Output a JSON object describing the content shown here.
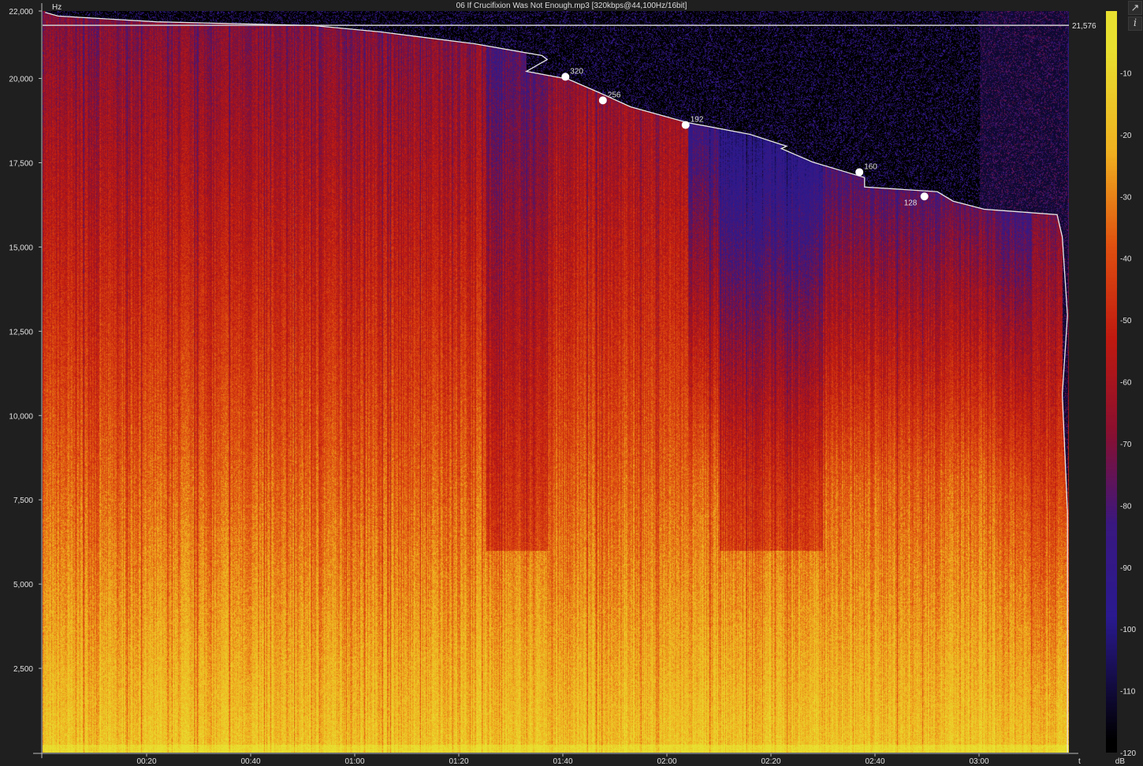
{
  "title": "06 If Crucifixion Was Not Enough.mp3 [320kbps@44,100Hz/16bit]",
  "toolbar": {
    "icons": [
      "open-external-icon",
      "info-icon"
    ],
    "info_label": "i"
  },
  "chart_data": {
    "type": "heatmap",
    "title": "06 If Crucifixion Was Not Enough.mp3 [320kbps@44,100Hz/16bit]",
    "xlabel": "t",
    "ylabel": "Hz",
    "colorbar_label": "dB",
    "xlim_seconds": [
      0,
      197
    ],
    "ylim": [
      0,
      22000
    ],
    "x_ticks": [
      "00:20",
      "00:40",
      "01:00",
      "01:20",
      "01:40",
      "02:00",
      "02:20",
      "02:40",
      "03:00"
    ],
    "y_ticks": [
      "22,000",
      "20,000",
      "17,500",
      "15,000",
      "12,500",
      "10,000",
      "7,500",
      "5,000",
      "2,500"
    ],
    "y_tick_values": [
      22000,
      20000,
      17500,
      15000,
      12500,
      10000,
      7500,
      5000,
      2500
    ],
    "colorbar_ticks": [
      "-10",
      "-20",
      "-30",
      "-40",
      "-50",
      "-60",
      "-70",
      "-80",
      "-90",
      "-100",
      "-110",
      "-120"
    ],
    "colorbar_range_db": [
      -120,
      0
    ],
    "colormap": [
      "#000000",
      "#2a1a90",
      "#3a1880",
      "#8a1030",
      "#c01a10",
      "#e05010",
      "#f0b020",
      "#e8e030"
    ],
    "cutoff_reference": {
      "value_hz": 21576,
      "label": "21,576"
    },
    "cutoff_curve": {
      "t": [
        0.5,
        3,
        22,
        52,
        65,
        83,
        96,
        97,
        93,
        101,
        107,
        113,
        124,
        136,
        143,
        142,
        148,
        158,
        158,
        172,
        175,
        181,
        195,
        196,
        197,
        196,
        197,
        197
      ],
      "hz": [
        21960,
        21850,
        21680,
        21570,
        21380,
        21030,
        20680,
        20560,
        20210,
        19980,
        19580,
        19160,
        18690,
        18340,
        17990,
        17920,
        17520,
        17060,
        16780,
        16640,
        16360,
        16120,
        15960,
        15300,
        12970,
        10630,
        7130,
        0
      ]
    },
    "bitrate_markers": [
      {
        "label": "320",
        "t": 100.5,
        "hz": 20050
      },
      {
        "label": "256",
        "t": 107.7,
        "hz": 19350
      },
      {
        "label": "192",
        "t": 123.6,
        "hz": 18620
      },
      {
        "label": "160",
        "t": 157,
        "hz": 17220
      },
      {
        "label": "128",
        "t": 169.5,
        "hz": 16500
      }
    ]
  }
}
